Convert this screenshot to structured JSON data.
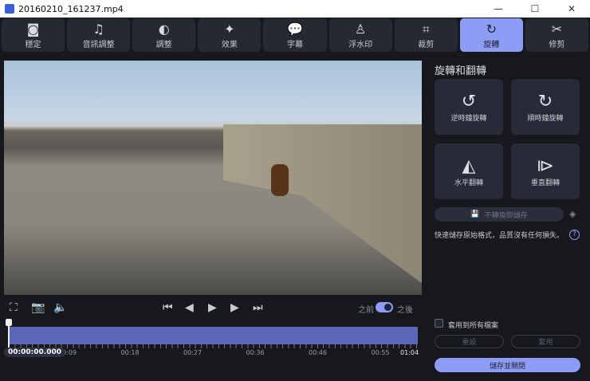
{
  "window": {
    "title": "20160210_161237.mp4",
    "minimize": "—",
    "maximize": "☐",
    "close": "✕"
  },
  "tabs": [
    {
      "label": "穩定",
      "icon": "stabilize-icon",
      "glyph": "◙"
    },
    {
      "label": "音訊調整",
      "icon": "music-note-icon",
      "glyph": "♫"
    },
    {
      "label": "調整",
      "icon": "contrast-icon",
      "glyph": "◐"
    },
    {
      "label": "效果",
      "icon": "magic-wand-icon",
      "glyph": "✦"
    },
    {
      "label": "字幕",
      "icon": "speech-bubble-icon",
      "glyph": "💬"
    },
    {
      "label": "浮水印",
      "icon": "stamp-icon",
      "glyph": "♙"
    },
    {
      "label": "裁剪",
      "icon": "crop-icon",
      "glyph": "⌗"
    },
    {
      "label": "旋轉",
      "icon": "rotate-icon",
      "glyph": "↻",
      "active": true
    },
    {
      "label": "修剪",
      "icon": "scissors-icon",
      "glyph": "✂"
    }
  ],
  "panel": {
    "title": "旋轉和翻轉",
    "ccw": "逆時鐘旋轉",
    "cw": "順時鐘旋轉",
    "flip_h": "水平翻轉",
    "flip_v": "垂直翻轉",
    "lossless": "不轉換即儲存",
    "note": "快速儲存原始格式，品質沒有任何損失。",
    "apply_all": "套用到所有檔案",
    "reset": "重設",
    "apply": "套用",
    "save_close": "儲存並關閉"
  },
  "player": {
    "before": "之前",
    "after": "之後",
    "after_enabled": true,
    "current_time": "00:00:00.000",
    "ticks": [
      "00:09",
      "00:18",
      "00:27",
      "00:36",
      "00:46",
      "00:55",
      "01:04"
    ]
  },
  "colors": {
    "accent": "#8d9cf5",
    "timeline": "#5a66b8"
  }
}
